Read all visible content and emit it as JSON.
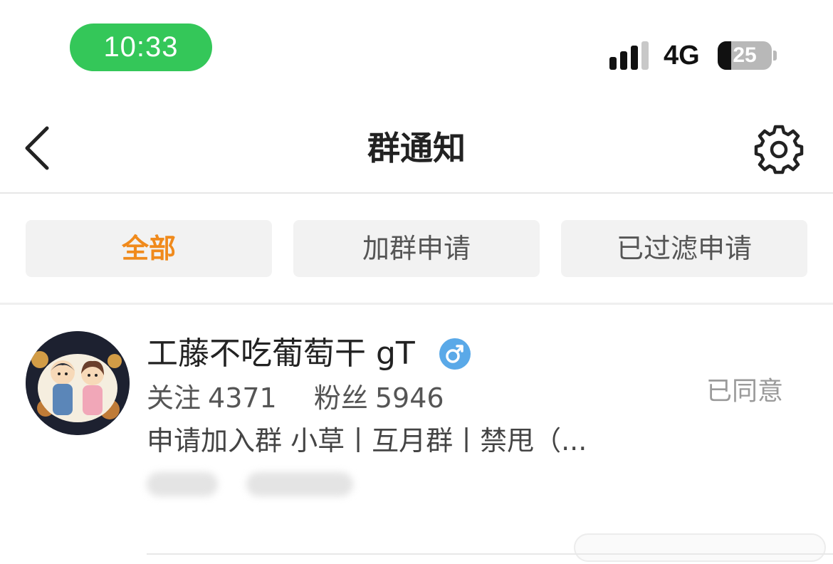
{
  "status_bar": {
    "time": "10:33",
    "network": "4G",
    "battery_level": "25",
    "time_pill_color": "#34c759",
    "icons": [
      "signal-icon",
      "battery-icon"
    ]
  },
  "nav": {
    "title": "群通知",
    "back_icon": "chevron-left-icon",
    "settings_icon": "gear-icon"
  },
  "tabs": [
    {
      "label": "全部",
      "active": true
    },
    {
      "label": "加群申请",
      "active": false
    },
    {
      "label": "已过滤申请",
      "active": false
    }
  ],
  "accent_color": "#f08a1c",
  "notifications": [
    {
      "username": "工藤不吃葡萄干 gT",
      "gender_icon": "male-icon",
      "gender_color": "#5aa9e8",
      "stats": {
        "following_label": "关注",
        "following": "4371",
        "followers_label": "粉丝",
        "followers": "5946"
      },
      "message": "申请加入群 小草丨互月群丨禁甩（...",
      "status": "已同意"
    }
  ]
}
